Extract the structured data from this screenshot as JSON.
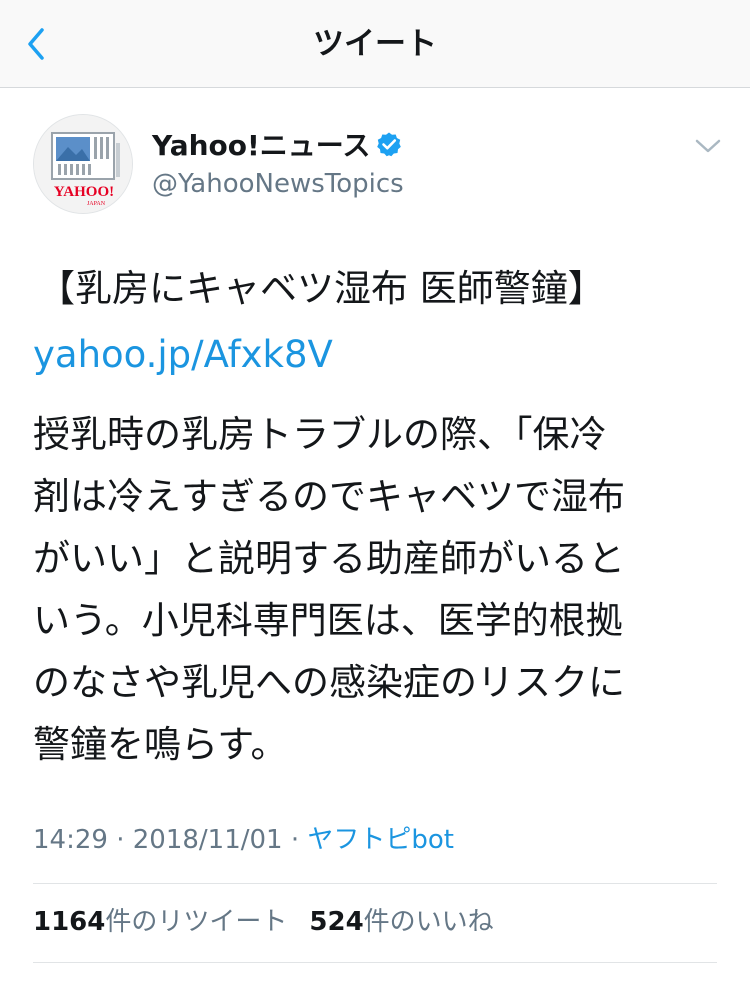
{
  "header": {
    "title": "ツイート",
    "back_icon": "chevron-left-icon"
  },
  "author": {
    "display_name": "Yahoo!ニュース",
    "username": "@YahooNewsTopics",
    "verified": true,
    "avatar_logo_text": "YAHOO!",
    "avatar_logo_sub": "JAPAN"
  },
  "tweet": {
    "headline": "【乳房にキャベツ湿布 医師警鐘】",
    "link": "yahoo.jp/Afxk8V",
    "body_lines": [
      "授乳時の乳房トラブルの際、「保冷",
      "剤は冷えすぎるのでキャベツで湿布",
      "がいい」と説明する助産師がいると",
      "いう。小児科専門医は、医学的根拠",
      "のなさや乳児への感染症のリスクに",
      "警鐘を鳴らす。"
    ],
    "time": "14:29",
    "date": "2018/11/01",
    "separator": "·",
    "source": "ヤフトピbot"
  },
  "stats": {
    "retweets_count": "1164",
    "retweets_label": "件のリツイート",
    "likes_count": "524",
    "likes_label": "件のいいね"
  },
  "colors": {
    "link": "#1b95e0",
    "secondary_text": "#657786",
    "primary_text": "#14171a",
    "verified": "#1da1f2",
    "logo_red": "#e60023"
  }
}
